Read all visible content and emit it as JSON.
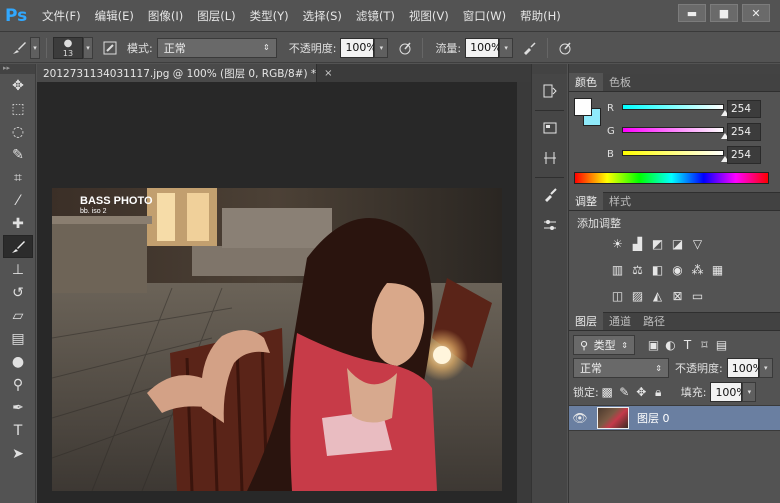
{
  "app": {
    "logo": "Ps"
  },
  "menu": [
    "文件(F)",
    "编辑(E)",
    "图像(I)",
    "图层(L)",
    "类型(Y)",
    "选择(S)",
    "滤镜(T)",
    "视图(V)",
    "窗口(W)",
    "帮助(H)"
  ],
  "window_controls": {
    "minimize": "▬",
    "maximize": "■",
    "close": "✕"
  },
  "options_bar": {
    "brush_size": "13",
    "mode_label": "模式:",
    "mode_value": "正常",
    "opacity_label": "不透明度:",
    "opacity_value": "100%",
    "flow_label": "流量:",
    "flow_value": "100%"
  },
  "document": {
    "tab_title": "2012731134031117.jpg @ 100% (图层 0, RGB/8#) *",
    "close": "×",
    "watermark_line1": "BASS    PHOTO",
    "watermark_line2": "bb.        iso    2"
  },
  "color_panel": {
    "tabs": [
      "颜色",
      "色板"
    ],
    "channels": [
      {
        "label": "R",
        "value": "254",
        "color_from": "#ffffff",
        "color_to": "#00ffff"
      },
      {
        "label": "G",
        "value": "254",
        "color_from": "#fe00fe",
        "color_to": "#fefefe"
      },
      {
        "label": "B",
        "value": "254",
        "color_from": "#fefe00",
        "color_to": "#fefefe"
      }
    ],
    "foreground": "#fefefe",
    "background": "#8feafa"
  },
  "adjust_panel": {
    "tabs": [
      "调整",
      "样式"
    ],
    "title": "添加调整"
  },
  "layers_panel": {
    "tabs": [
      "图层",
      "通道",
      "路径"
    ],
    "filter_label": "类型",
    "blend_mode": "正常",
    "opacity_label": "不透明度:",
    "opacity_value": "100%",
    "lock_label": "锁定:",
    "fill_label": "填充:",
    "fill_value": "100%",
    "layers": [
      {
        "name": "图层 0",
        "visible": true
      }
    ]
  },
  "colors": {
    "accent": "#31a8ff",
    "selected_layer": "#6a7fa1",
    "canvas_bg": "#282828"
  }
}
